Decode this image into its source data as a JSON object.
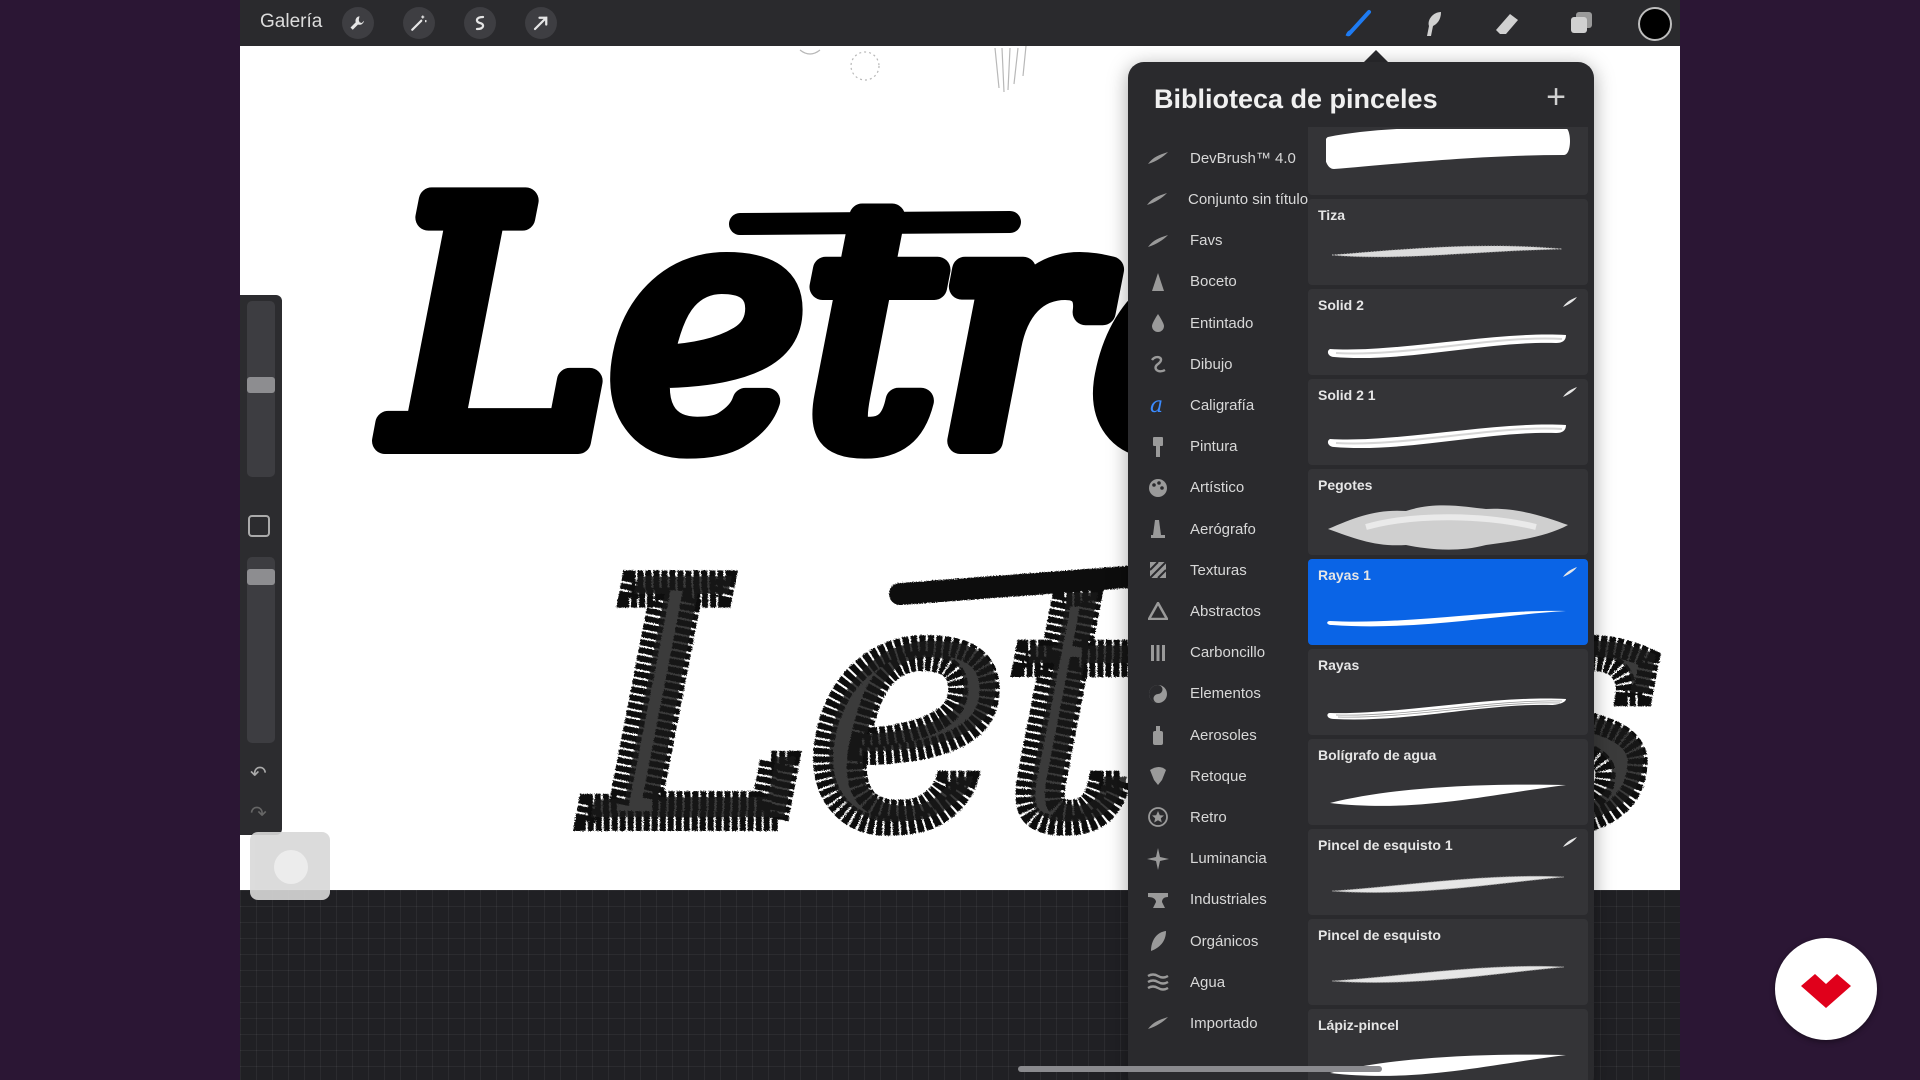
{
  "topbar": {
    "gallery_label": "Galería",
    "icons": [
      "wrench-icon",
      "magic-wand-icon",
      "selection-icon",
      "arrow-icon"
    ],
    "tools": [
      "brush-icon",
      "smudge-icon",
      "eraser-icon",
      "layers-icon"
    ],
    "current_color": "#000000"
  },
  "panel": {
    "title": "Biblioteca de pinceles",
    "add_label": "+",
    "sets": [
      {
        "label": "Conjunto sin título",
        "icon": "brush-set-icon"
      },
      {
        "label": "DevBrush™ 4.0",
        "icon": "brush-set-icon"
      },
      {
        "label": "Conjunto sin título",
        "icon": "brush-set-icon"
      },
      {
        "label": "Favs",
        "icon": "brush-set-icon"
      },
      {
        "label": "Boceto",
        "icon": "pencil-tip-icon"
      },
      {
        "label": "Entintado",
        "icon": "ink-drop-icon"
      },
      {
        "label": "Dibujo",
        "icon": "squiggle-icon"
      },
      {
        "label": "Caligrafía",
        "icon": "calligraphy-icon"
      },
      {
        "label": "Pintura",
        "icon": "paintbrush-icon"
      },
      {
        "label": "Artístico",
        "icon": "palette-icon"
      },
      {
        "label": "Aerógrafo",
        "icon": "airbrush-icon"
      },
      {
        "label": "Texturas",
        "icon": "texture-icon"
      },
      {
        "label": "Abstractos",
        "icon": "triangle-icon"
      },
      {
        "label": "Carboncillo",
        "icon": "charcoal-icon"
      },
      {
        "label": "Elementos",
        "icon": "yin-yang-icon"
      },
      {
        "label": "Aerosoles",
        "icon": "spray-can-icon"
      },
      {
        "label": "Retoque",
        "icon": "retouch-icon"
      },
      {
        "label": "Retro",
        "icon": "star-badge-icon"
      },
      {
        "label": "Luminancia",
        "icon": "sparkle-icon"
      },
      {
        "label": "Industriales",
        "icon": "anvil-icon"
      },
      {
        "label": "Orgánicos",
        "icon": "leaf-icon"
      },
      {
        "label": "Agua",
        "icon": "waves-icon"
      },
      {
        "label": "Importado",
        "icon": "brush-set-icon"
      }
    ],
    "brushes": [
      {
        "name": "",
        "selected": false,
        "badge": false,
        "stroke": "solid-fat"
      },
      {
        "name": "Tiza",
        "selected": false,
        "badge": false,
        "stroke": "chalk"
      },
      {
        "name": "Solid 2",
        "selected": false,
        "badge": true,
        "stroke": "smooth"
      },
      {
        "name": "Solid 2 1",
        "selected": false,
        "badge": true,
        "stroke": "smooth"
      },
      {
        "name": "Pegotes",
        "selected": false,
        "badge": false,
        "stroke": "blob"
      },
      {
        "name": "Rayas 1",
        "selected": true,
        "badge": true,
        "stroke": "thin"
      },
      {
        "name": "Rayas",
        "selected": false,
        "badge": false,
        "stroke": "striped"
      },
      {
        "name": "Bolígrafo de agua",
        "selected": false,
        "badge": false,
        "stroke": "tapered"
      },
      {
        "name": "Pincel de esquisto 1",
        "selected": false,
        "badge": true,
        "stroke": "slate"
      },
      {
        "name": "Pincel de esquisto",
        "selected": false,
        "badge": false,
        "stroke": "slate"
      },
      {
        "name": "Lápiz-pincel",
        "selected": false,
        "badge": false,
        "stroke": "tapered"
      }
    ]
  },
  "canvas": {
    "word_solid": "Letras",
    "word_textured": "Letras"
  },
  "colors": {
    "selected_accent": "#0a64e6",
    "logo_red": "#e0001b",
    "background": "#2b1634"
  }
}
